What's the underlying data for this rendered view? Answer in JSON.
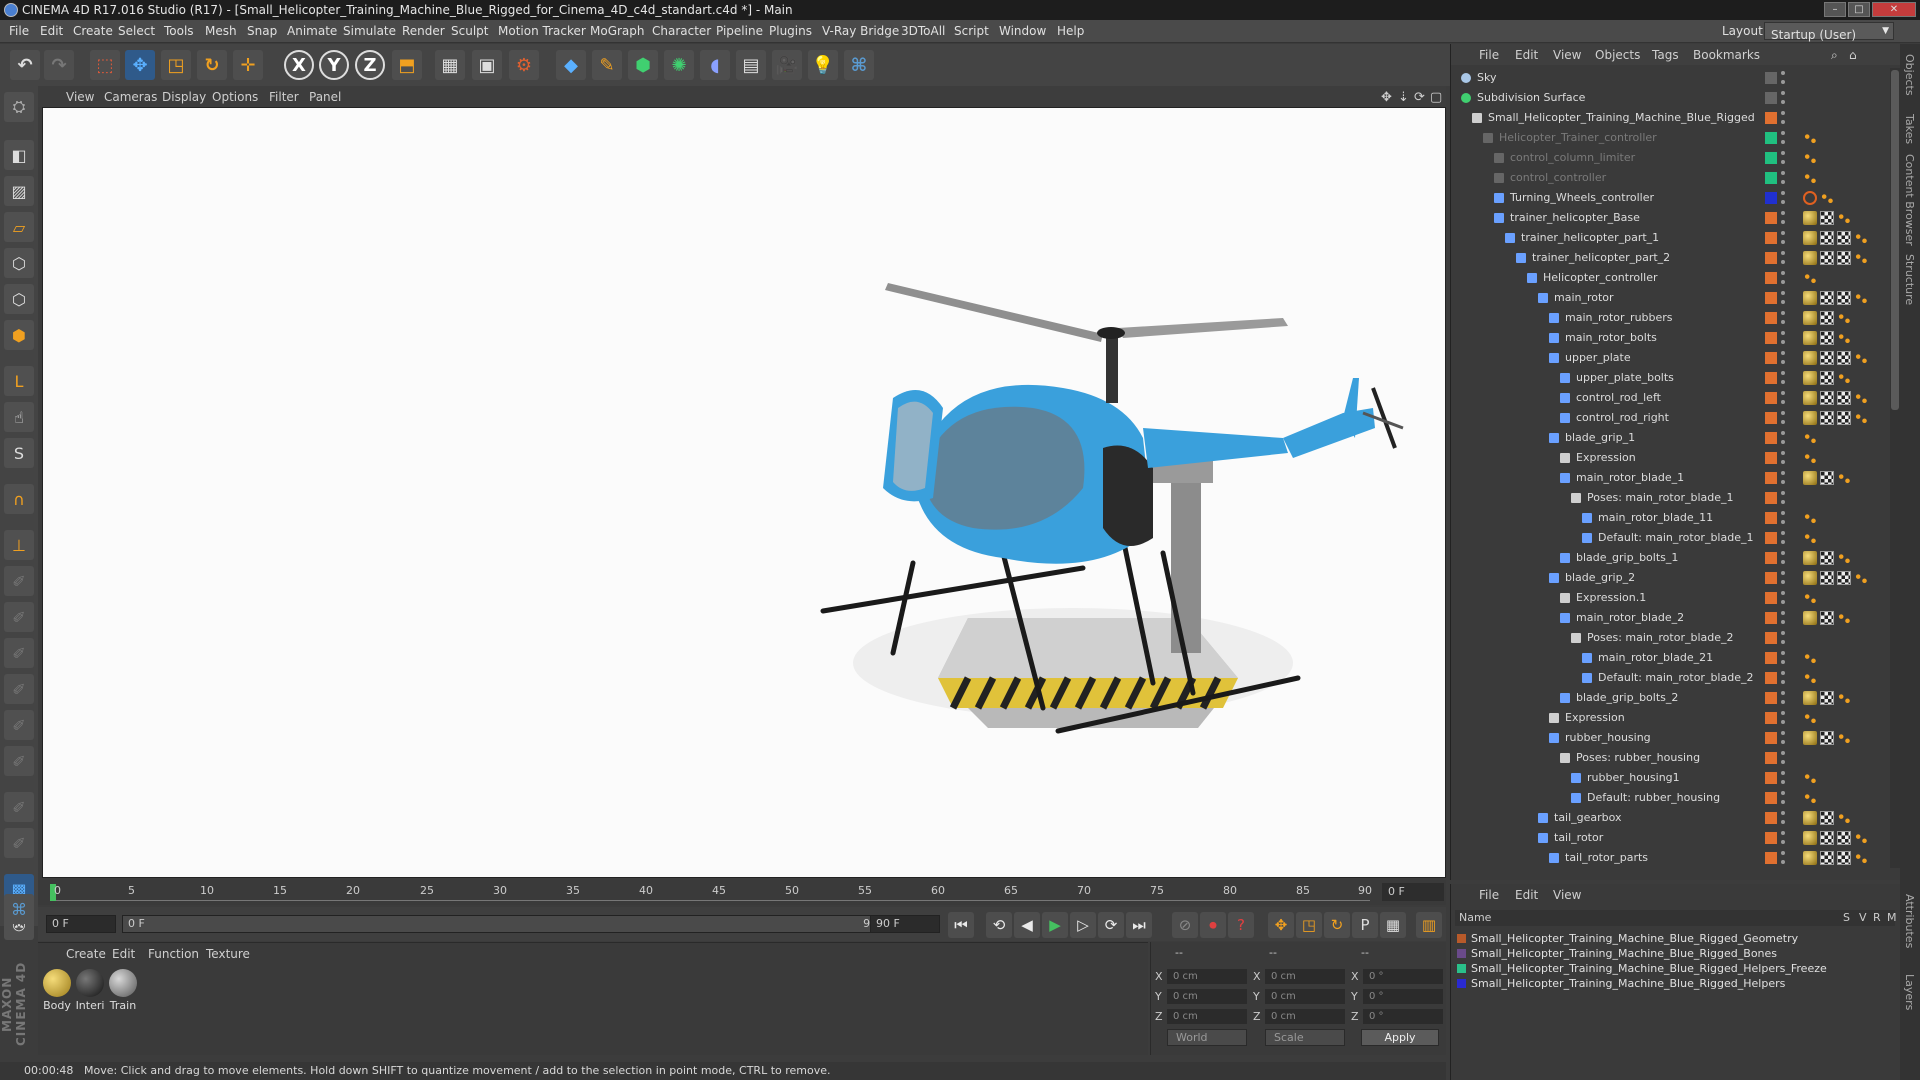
{
  "titlebar": {
    "title": "CINEMA 4D R17.016 Studio (R17) - [Small_Helicopter_Training_Machine_Blue_Rigged_for_Cinema_4D_c4d_standart.c4d *] - Main"
  },
  "menu": [
    "File",
    "Edit",
    "Create",
    "Select",
    "Tools",
    "Mesh",
    "Snap",
    "Animate",
    "Simulate",
    "Render",
    "Sculpt",
    "Motion Tracker",
    "MoGraph",
    "Character",
    "Pipeline",
    "Plugins",
    "V-Ray Bridge",
    "3DToAll",
    "Script",
    "Window",
    "Help"
  ],
  "layout": {
    "label": "Layout:",
    "value": "Startup (User)"
  },
  "viewport_menu": [
    "View",
    "Cameras",
    "Display",
    "Options",
    "Filter",
    "Panel"
  ],
  "timeline": {
    "ticks": [
      "0",
      "5",
      "10",
      "15",
      "20",
      "25",
      "30",
      "35",
      "40",
      "45",
      "50",
      "55",
      "60",
      "65",
      "70",
      "75",
      "80",
      "85",
      "90"
    ],
    "current_frame": "0 F"
  },
  "transport": {
    "start": "0 F",
    "range_start": "0 F",
    "range_end": "90 F",
    "end": "90 F"
  },
  "material_menu": [
    "Create",
    "Edit",
    "Function",
    "Texture"
  ],
  "materials": [
    {
      "label": "Body",
      "color": "#c9a83a"
    },
    {
      "label": "Interi",
      "color": "#2a2a2a"
    },
    {
      "label": "Train",
      "color": "#8a8a8a"
    }
  ],
  "coords": {
    "head": [
      "--",
      "--",
      "--"
    ],
    "rows": [
      {
        "a": "X",
        "av": "0 cm",
        "b": "X",
        "bv": "0 cm",
        "c": "X",
        "cv": "0 °"
      },
      {
        "a": "Y",
        "av": "0 cm",
        "b": "Y",
        "bv": "0 cm",
        "c": "Y",
        "cv": "0 °"
      },
      {
        "a": "Z",
        "av": "0 cm",
        "b": "Z",
        "bv": "0 cm",
        "c": "Z",
        "cv": "0 °"
      }
    ],
    "mode": "World",
    "scale": "Scale",
    "apply": "Apply"
  },
  "status": {
    "time": "00:00:48",
    "message": "Move: Click and drag to move elements. Hold down SHIFT to quantize movement / add to the selection in point mode, CTRL to remove."
  },
  "object_menu": [
    "File",
    "Edit",
    "View",
    "Objects",
    "Tags",
    "Bookmarks"
  ],
  "objects": [
    {
      "name": "Sky",
      "indent": 0,
      "icon": "sky",
      "dim": false,
      "tags": []
    },
    {
      "name": "Subdivision Surface",
      "indent": 0,
      "icon": "subdiv",
      "dim": false,
      "tags": []
    },
    {
      "name": "Small_Helicopter_Training_Machine_Blue_Rigged",
      "indent": 1,
      "icon": "null",
      "dim": false,
      "tags": []
    },
    {
      "name": "Helicopter_Trainer_controller",
      "indent": 2,
      "icon": "bone",
      "dim": true,
      "tags": [
        "dots"
      ]
    },
    {
      "name": "control_column_limiter",
      "indent": 3,
      "icon": "bone",
      "dim": true,
      "tags": [
        "dots"
      ]
    },
    {
      "name": "control_controller",
      "indent": 3,
      "icon": "bone",
      "dim": true,
      "tags": [
        "dots"
      ]
    },
    {
      "name": "Turning_Wheels_controller",
      "indent": 3,
      "icon": "joint",
      "dim": false,
      "tags": [
        "no",
        "dots"
      ]
    },
    {
      "name": "trainer_helicopter_Base",
      "indent": 3,
      "icon": "joint",
      "dim": false,
      "tags": [
        "mat",
        "chk",
        "dots"
      ]
    },
    {
      "name": "trainer_helicopter_part_1",
      "indent": 4,
      "icon": "joint",
      "dim": false,
      "tags": [
        "mat",
        "chk",
        "chk",
        "dots"
      ]
    },
    {
      "name": "trainer_helicopter_part_2",
      "indent": 5,
      "icon": "joint",
      "dim": false,
      "tags": [
        "mat",
        "chk",
        "chk",
        "dots"
      ]
    },
    {
      "name": "Helicopter_controller",
      "indent": 6,
      "icon": "joint",
      "dim": false,
      "tags": [
        "dots"
      ]
    },
    {
      "name": "main_rotor",
      "indent": 7,
      "icon": "joint",
      "dim": false,
      "tags": [
        "mat",
        "chk",
        "chk",
        "dots"
      ]
    },
    {
      "name": "main_rotor_rubbers",
      "indent": 8,
      "icon": "joint",
      "dim": false,
      "tags": [
        "mat",
        "chk",
        "dots"
      ]
    },
    {
      "name": "main_rotor_bolts",
      "indent": 8,
      "icon": "joint",
      "dim": false,
      "tags": [
        "mat",
        "chk",
        "dots"
      ]
    },
    {
      "name": "upper_plate",
      "indent": 8,
      "icon": "joint",
      "dim": false,
      "tags": [
        "mat",
        "chk",
        "chk",
        "dots"
      ]
    },
    {
      "name": "upper_plate_bolts",
      "indent": 9,
      "icon": "joint",
      "dim": false,
      "tags": [
        "mat",
        "chk",
        "dots"
      ]
    },
    {
      "name": "control_rod_left",
      "indent": 9,
      "icon": "joint",
      "dim": false,
      "tags": [
        "mat",
        "chk",
        "chk",
        "dots"
      ]
    },
    {
      "name": "control_rod_right",
      "indent": 9,
      "icon": "joint",
      "dim": false,
      "tags": [
        "mat",
        "chk",
        "chk",
        "dots"
      ]
    },
    {
      "name": "blade_grip_1",
      "indent": 8,
      "icon": "joint",
      "dim": false,
      "tags": [
        "dots"
      ]
    },
    {
      "name": "Expression",
      "indent": 9,
      "icon": "null",
      "dim": false,
      "tags": [
        "dots"
      ]
    },
    {
      "name": "main_rotor_blade_1",
      "indent": 9,
      "icon": "joint",
      "dim": false,
      "tags": [
        "mat",
        "chk",
        "dots"
      ]
    },
    {
      "name": "Poses: main_rotor_blade_1",
      "indent": 10,
      "icon": "null",
      "dim": false,
      "tags": []
    },
    {
      "name": "main_rotor_blade_11",
      "indent": 11,
      "icon": "joint",
      "dim": false,
      "tags": [
        "dots"
      ]
    },
    {
      "name": "Default: main_rotor_blade_1",
      "indent": 11,
      "icon": "joint",
      "dim": false,
      "tags": [
        "dots"
      ]
    },
    {
      "name": "blade_grip_bolts_1",
      "indent": 9,
      "icon": "joint",
      "dim": false,
      "tags": [
        "mat",
        "chk",
        "dots"
      ]
    },
    {
      "name": "blade_grip_2",
      "indent": 8,
      "icon": "joint",
      "dim": false,
      "tags": [
        "mat",
        "chk",
        "chk",
        "dots"
      ]
    },
    {
      "name": "Expression.1",
      "indent": 9,
      "icon": "null",
      "dim": false,
      "tags": [
        "dots"
      ]
    },
    {
      "name": "main_rotor_blade_2",
      "indent": 9,
      "icon": "joint",
      "dim": false,
      "tags": [
        "mat",
        "chk",
        "dots"
      ]
    },
    {
      "name": "Poses: main_rotor_blade_2",
      "indent": 10,
      "icon": "null",
      "dim": false,
      "tags": []
    },
    {
      "name": "main_rotor_blade_21",
      "indent": 11,
      "icon": "joint",
      "dim": false,
      "tags": [
        "dots"
      ]
    },
    {
      "name": "Default: main_rotor_blade_2",
      "indent": 11,
      "icon": "joint",
      "dim": false,
      "tags": [
        "dots"
      ]
    },
    {
      "name": "blade_grip_bolts_2",
      "indent": 9,
      "icon": "joint",
      "dim": false,
      "tags": [
        "mat",
        "chk",
        "dots"
      ]
    },
    {
      "name": "Expression",
      "indent": 8,
      "icon": "null",
      "dim": false,
      "tags": [
        "dots"
      ]
    },
    {
      "name": "rubber_housing",
      "indent": 8,
      "icon": "joint",
      "dim": false,
      "tags": [
        "mat",
        "chk",
        "dots"
      ]
    },
    {
      "name": "Poses: rubber_housing",
      "indent": 9,
      "icon": "null",
      "dim": false,
      "tags": []
    },
    {
      "name": "rubber_housing1",
      "indent": 10,
      "icon": "joint",
      "dim": false,
      "tags": [
        "dots"
      ]
    },
    {
      "name": "Default: rubber_housing",
      "indent": 10,
      "icon": "joint",
      "dim": false,
      "tags": [
        "dots"
      ]
    },
    {
      "name": "tail_gearbox",
      "indent": 7,
      "icon": "joint",
      "dim": false,
      "tags": [
        "mat",
        "chk",
        "dots"
      ]
    },
    {
      "name": "tail_rotor",
      "indent": 7,
      "icon": "joint",
      "dim": false,
      "tags": [
        "mat",
        "chk",
        "chk",
        "dots"
      ]
    },
    {
      "name": "tail_rotor_parts",
      "indent": 8,
      "icon": "joint",
      "dim": false,
      "tags": [
        "mat",
        "chk",
        "chk",
        "dots"
      ]
    }
  ],
  "layer_menu": [
    "File",
    "Edit",
    "View"
  ],
  "layer_head": {
    "name": "Name",
    "cols": [
      "S",
      "V",
      "R",
      "M"
    ]
  },
  "layers": [
    {
      "name": "Small_Helicopter_Training_Machine_Blue_Rigged_Geometry",
      "color": "#b85a2a"
    },
    {
      "name": "Small_Helicopter_Training_Machine_Blue_Rigged_Bones",
      "color": "#6a4a8a"
    },
    {
      "name": "Small_Helicopter_Training_Machine_Blue_Rigged_Helpers_Freeze",
      "color": "#2ac08a"
    },
    {
      "name": "Small_Helicopter_Training_Machine_Blue_Rigged_Helpers",
      "color": "#2a2ad0"
    }
  ],
  "right_tabs": [
    "Objects",
    "Takes",
    "Content Browser",
    "Structure",
    "Attributes",
    "Layers"
  ],
  "maxon": "MAXON CINEMA 4D"
}
